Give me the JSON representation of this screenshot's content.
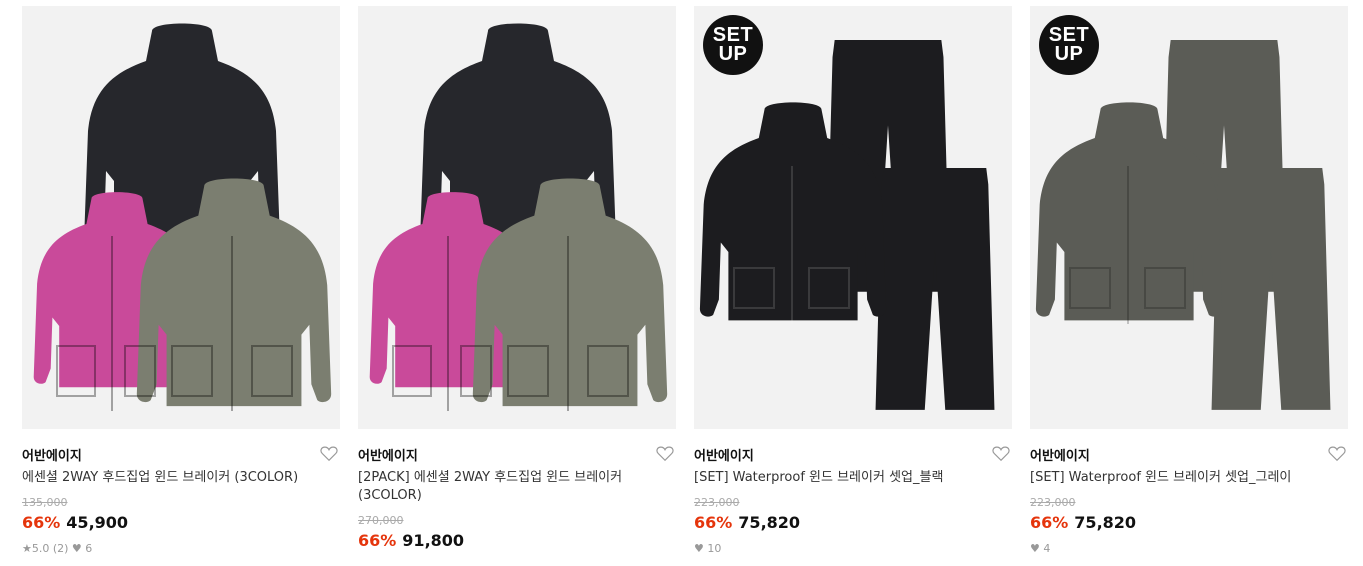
{
  "products": [
    {
      "brand": "어반에이지",
      "name": "에센셜 2WAY 후드집업 윈드 브레이커 (3COLOR)",
      "original_price": "135,000",
      "discount": "66%",
      "price": "45,900",
      "meta": "★5.0 (2)   ♥ 6",
      "image": "three-hooded-windbreakers-black-pink-khaki",
      "badge": null
    },
    {
      "brand": "어반에이지",
      "name": "[2PACK] 에센셜 2WAY 후드집업 윈드 브레이커 (3COLOR)",
      "original_price": "270,000",
      "discount": "66%",
      "price": "91,800",
      "meta": "",
      "image": "three-hooded-windbreakers-black-pink-khaki",
      "badge": null
    },
    {
      "brand": "어반에이지",
      "name": "[SET] Waterproof 윈드 브레이커 셋업_블랙",
      "original_price": "223,000",
      "discount": "66%",
      "price": "75,820",
      "meta": "♥ 10",
      "image": "black-windbreaker-and-two-pants",
      "badge": [
        "SET",
        "UP"
      ]
    },
    {
      "brand": "어반에이지",
      "name": "[SET] Waterproof 윈드 브레이커 셋업_그레이",
      "original_price": "223,000",
      "discount": "66%",
      "price": "75,820",
      "meta": "♥ 4",
      "image": "grey-windbreaker-and-two-pants",
      "badge": [
        "SET",
        "UP"
      ]
    }
  ],
  "colors": {
    "discount": "#e5350c",
    "thumb_bg": "#f2f2f2",
    "black_jacket": "#26272c",
    "pink_jacket": "#c94a9a",
    "khaki_jacket": "#7b7e70",
    "black_set": "#1c1c1f",
    "grey_set": "#5b5c56"
  },
  "icons": {
    "wishlist": "heart-outline-icon"
  }
}
